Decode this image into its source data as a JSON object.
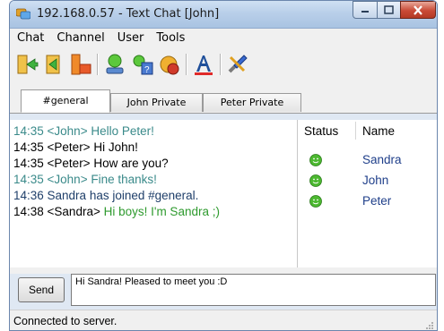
{
  "window": {
    "title": "192.168.0.57 - Text Chat [John]"
  },
  "menu": [
    "Chat",
    "Channel",
    "User",
    "Tools"
  ],
  "toolbar_icons": [
    "connect-icon",
    "disconnect-icon",
    "join-channel-icon",
    "leave-channel-icon",
    "user-icon",
    "user-info-icon",
    "away-icon",
    "font-icon",
    "settings-tools-icon"
  ],
  "tabs": [
    {
      "label": "#general",
      "active": true
    },
    {
      "label": "John Private",
      "active": false
    },
    {
      "label": "Peter Private",
      "active": false
    }
  ],
  "chat": [
    {
      "text": "14:35 <John> Hello Peter!",
      "color": "#3a8a8a"
    },
    {
      "text": "14:35 <Peter> Hi John!",
      "color": "#000000"
    },
    {
      "text": "14:35 <Peter> How are you?",
      "color": "#000000"
    },
    {
      "text": "14:35 <John> Fine thanks!",
      "color": "#3a8a8a"
    },
    {
      "text": "14:36 Sandra has joined #general.",
      "color": "#1f3f6a"
    },
    {
      "time": "14:38 <Sandra>",
      "msg": " Hi boys! I'm Sandra ;)",
      "color": "#2e9a2e"
    }
  ],
  "users": {
    "headers": {
      "status": "Status",
      "name": "Name"
    },
    "list": [
      {
        "name": "Sandra",
        "status": "online"
      },
      {
        "name": "John",
        "status": "online"
      },
      {
        "name": "Peter",
        "status": "online"
      }
    ]
  },
  "input": {
    "send_label": "Send",
    "value": "Hi Sandra! Pleased to meet you :D"
  },
  "status": {
    "text": "Connected to server."
  },
  "colors": {
    "online": "#4cb830",
    "title_bar": "#b9cfe9",
    "close_button": "#c94a36"
  }
}
